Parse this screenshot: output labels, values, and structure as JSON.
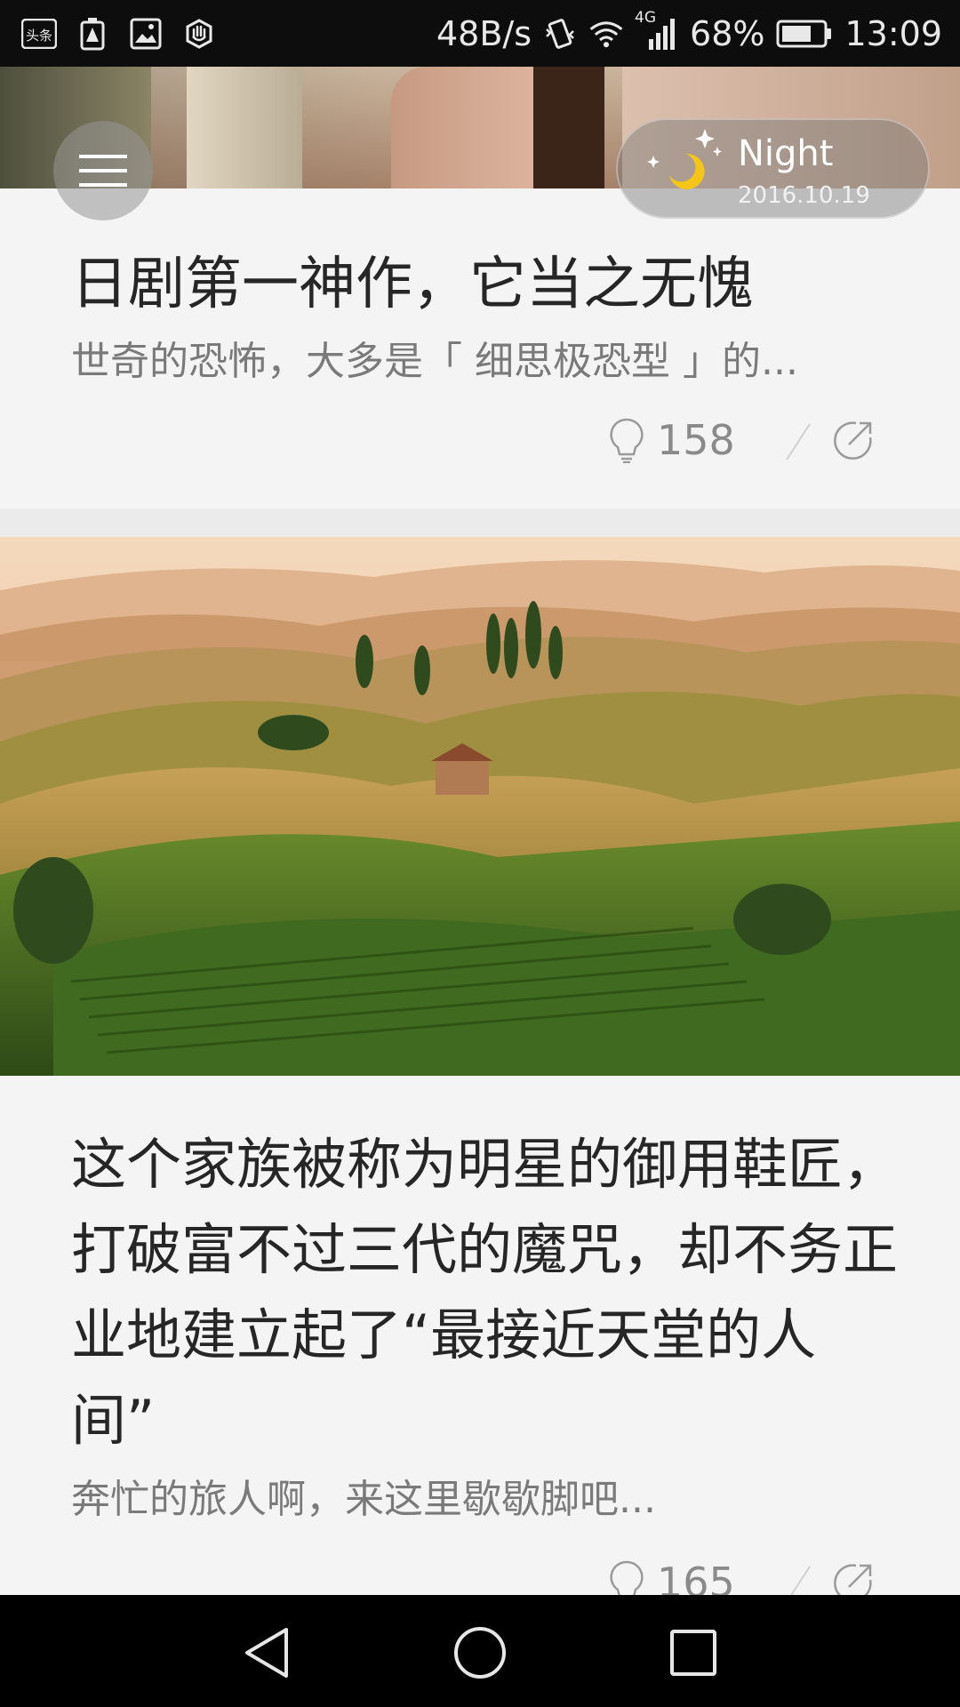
{
  "status_bar": {
    "left_icons": [
      "toutiao-app-icon",
      "battery-alert-icon",
      "image-icon",
      "hand-icon"
    ],
    "left_badge_text": "头条",
    "net_speed": "48B/s",
    "network_type": "4G",
    "battery_percent": "68%",
    "time": "13:09"
  },
  "header": {
    "mode_label": "Night",
    "date": "2016.10.19"
  },
  "articles": [
    {
      "title": "日剧第一神作，它当之无愧",
      "summary": "世奇的恐怖，大多是「 细思极恐型 」的...",
      "comment_count": "158"
    },
    {
      "title": "这个家族被称为明星的御用鞋匠，打破富不过三代的魔咒，却不务正业地建立起了“最接近天堂的人间”",
      "summary": "奔忙的旅人啊，来这里歇歇脚吧...",
      "comment_count": "165"
    }
  ],
  "colors": {
    "background": "#f4f4f4",
    "title_text": "#262626",
    "summary_text": "#7a7a7a",
    "moon": "#f5c518"
  }
}
